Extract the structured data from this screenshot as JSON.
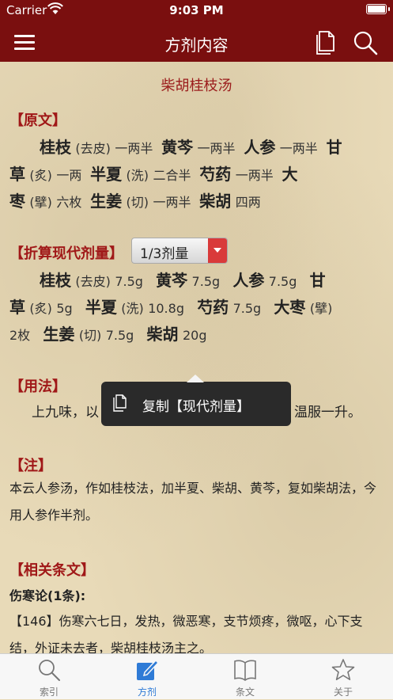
{
  "status": {
    "carrier": "Carrier",
    "time": "9:03 PM"
  },
  "nav": {
    "title": "方剂内容"
  },
  "formula": {
    "title": "柴胡桂枝汤",
    "original_header": "【原文】",
    "original": {
      "line1": [
        {
          "herb": "桂枝",
          "note": "(去皮)",
          "dose": "一两半"
        },
        {
          "herb": "黄芩",
          "note": "",
          "dose": "一两半"
        },
        {
          "herb": "人参",
          "note": "",
          "dose": "一两半"
        },
        {
          "herb": "甘",
          "note": "",
          "dose": ""
        }
      ],
      "line2": [
        {
          "herb": "草",
          "note": "(炙)",
          "dose": "一两"
        },
        {
          "herb": "半夏",
          "note": "(洗)",
          "dose": "二合半"
        },
        {
          "herb": "芍药",
          "note": "",
          "dose": "一两半"
        },
        {
          "herb": "大",
          "note": "",
          "dose": ""
        }
      ],
      "line3": [
        {
          "herb": "枣",
          "note": "(擘)",
          "dose": "六枚"
        },
        {
          "herb": "生姜",
          "note": "(切)",
          "dose": "一两半"
        },
        {
          "herb": "柴胡",
          "note": "",
          "dose": "四两"
        }
      ]
    },
    "modern_header": "【折算现代剂量】",
    "dosage_select": "1/3剂量",
    "modern": {
      "line1": [
        {
          "herb": "桂枝",
          "note": "(去皮)",
          "dose": "7.5g"
        },
        {
          "herb": "黄芩",
          "note": "",
          "dose": "7.5g"
        },
        {
          "herb": "人参",
          "note": "",
          "dose": "7.5g"
        },
        {
          "herb": "甘",
          "note": "",
          "dose": ""
        }
      ],
      "line2": [
        {
          "herb": "草",
          "note": "(炙)",
          "dose": "5g"
        },
        {
          "herb": "半夏",
          "note": "(洗)",
          "dose": "10.8g"
        },
        {
          "herb": "芍药",
          "note": "",
          "dose": "7.5g"
        },
        {
          "herb": "大枣",
          "note": "(擘)",
          "dose": ""
        }
      ],
      "line3": [
        {
          "herb": "",
          "note": "",
          "dose": "2枚"
        },
        {
          "herb": "生姜",
          "note": "(切)",
          "dose": "7.5g"
        },
        {
          "herb": "柴胡",
          "note": "",
          "dose": "20g"
        }
      ]
    },
    "usage_header": "【用法】",
    "usage_left": "上九味，以",
    "usage_right": "温服一升。",
    "notes_header": "【注】",
    "notes_text": "本云人参汤，作如桂枝法，加半夏、柴胡、黄芩，复如柴胡法，今用人参作半剂。",
    "related_header": "【相关条文】",
    "related_source": "伤寒论(1条):",
    "related_text": "【146】伤寒六七日，发热，微恶寒，支节烦疼，微呕，心下支结，外证未去者，柴胡桂枝汤主之。"
  },
  "popup": {
    "label": "复制【现代剂量】"
  },
  "tabs": [
    {
      "label": "索引",
      "icon": "magnifier-icon",
      "active": false
    },
    {
      "label": "方剂",
      "icon": "edit-icon",
      "active": true
    },
    {
      "label": "条文",
      "icon": "book-icon",
      "active": false
    },
    {
      "label": "关于",
      "icon": "star-icon",
      "active": false
    }
  ],
  "colors": {
    "nav_bg": "#7a0f0f",
    "heading_red": "#a01818",
    "tab_active": "#2f7bd6",
    "dropdown_button": "#d93a3a"
  }
}
